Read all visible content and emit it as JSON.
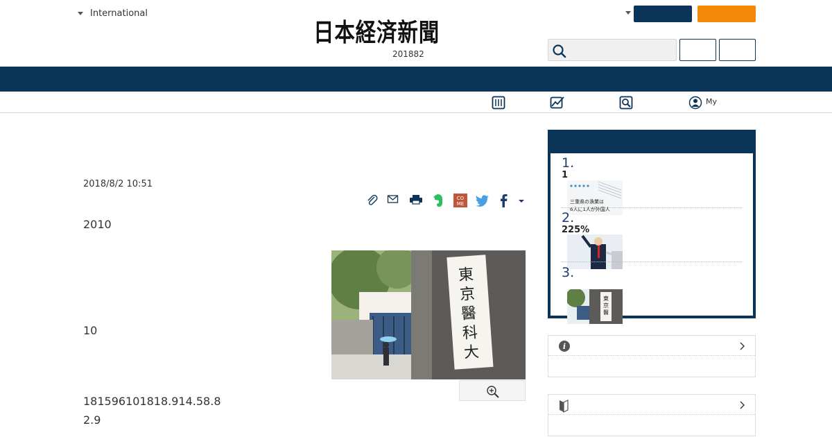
{
  "header": {
    "edition_label": "International",
    "logo_text": "日本経済新聞",
    "date_line": "201882",
    "search": {
      "placeholder": ""
    },
    "colors": {
      "navy": "#0b3558",
      "orange": "#f5890a"
    }
  },
  "subnav": {
    "icons": [
      "newspaper-icon",
      "chart-icon",
      "search-box-icon",
      "user-circle-icon"
    ],
    "my_label": "My"
  },
  "article": {
    "date": "2018/8/2 10:51",
    "paragraphs": [
      "2010",
      "10",
      "181596101818.914.58.8",
      "2.9"
    ],
    "share_icons": [
      "clip-icon",
      "mail-icon",
      "print-icon",
      "evernote-icon",
      "come-icon",
      "twitter-icon",
      "facebook-icon",
      "more-caret-icon"
    ],
    "photo_alt": "東京醫科大學"
  },
  "ranking": {
    "items": [
      {
        "rank": "1.",
        "title": "1"
      },
      {
        "rank": "2.",
        "title": "225%"
      },
      {
        "rank": "3.",
        "title": ""
      }
    ],
    "thumb1_text_line1": "三重県の漁業は",
    "thumb1_text_line2": "6人に1人が外国人"
  }
}
